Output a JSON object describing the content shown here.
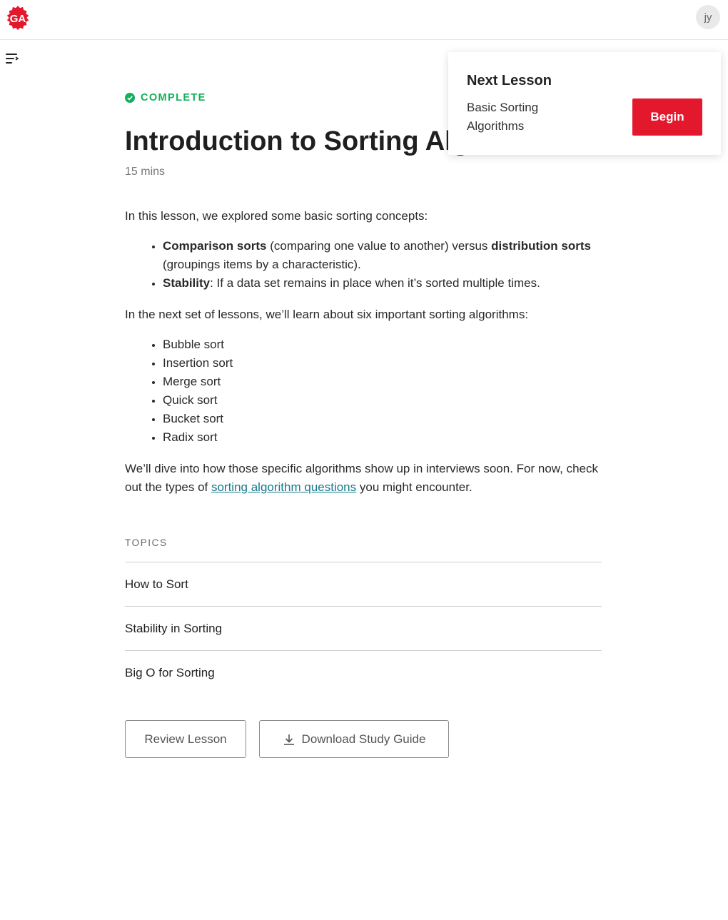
{
  "header": {
    "logo_text": "GA",
    "avatar_initials": "jy"
  },
  "lesson": {
    "status": "COMPLETE",
    "title": "Introduction to Sorting Algorithms",
    "duration": "15 mins",
    "intro": "In this lesson, we explored some basic sorting concepts:",
    "concepts": {
      "item1_bold1": "Comparison sorts",
      "item1_text1": " (comparing one value to another) versus ",
      "item1_bold2": "distribution sorts",
      "item1_text2": " (groupings items by a characteristic).",
      "item2_bold": "Stability",
      "item2_text": ": If a data set remains in place when it’s sorted multiple times."
    },
    "next_set_intro": "In the next set of lessons, we’ll learn about six important sorting algorithms:",
    "algorithms": [
      "Bubble sort",
      "Insertion sort",
      "Merge sort",
      "Quick sort",
      "Bucket sort",
      "Radix sort"
    ],
    "closing": {
      "text1": "We’ll dive into how those specific algorithms show up in interviews soon. For now, check out the types of ",
      "link": "sorting algorithm questions",
      "text2": " you might encounter."
    }
  },
  "topics": {
    "label": "TOPICS",
    "items": [
      "How to Sort",
      "Stability in Sorting",
      "Big O for Sorting"
    ]
  },
  "actions": {
    "review_label": "Review Lesson",
    "download_label": "Download Study Guide"
  },
  "next_lesson": {
    "heading": "Next Lesson",
    "title": "Basic Sorting Algorithms",
    "button_label": "Begin"
  },
  "colors": {
    "brand_red": "#e3182d",
    "complete_green": "#12b05a",
    "link_teal": "#167a8a"
  }
}
